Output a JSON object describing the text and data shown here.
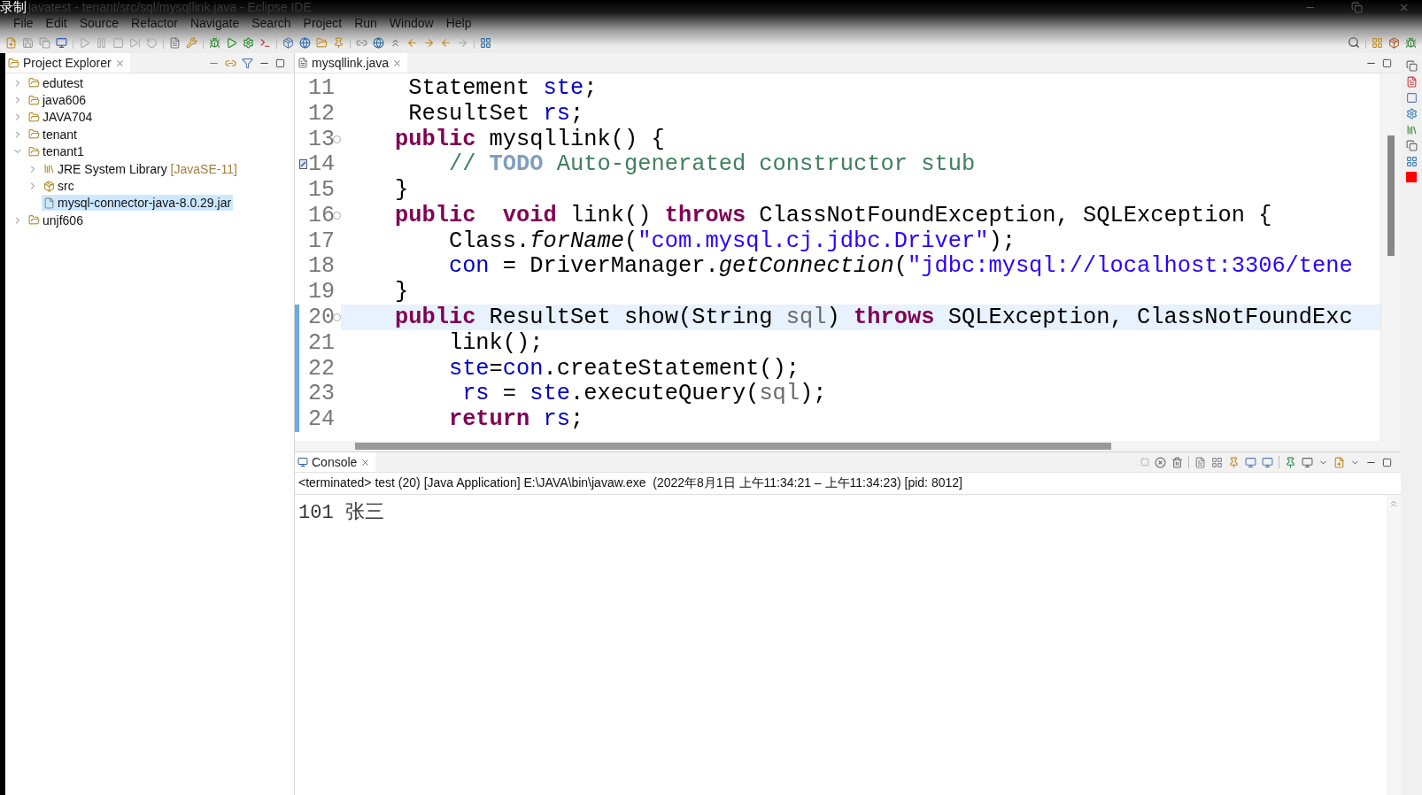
{
  "window": {
    "recording_label": "录制",
    "title": "javatest - tenant/src/sql/mysqllink.java - Eclipse IDE"
  },
  "menu": [
    "File",
    "Edit",
    "Source",
    "Refactor",
    "Navigate",
    "Search",
    "Project",
    "Run",
    "Window",
    "Help"
  ],
  "project_explorer": {
    "tab": "Project Explorer",
    "items": [
      {
        "label": "edutest",
        "kind": "project",
        "expanded": false,
        "selected": false
      },
      {
        "label": "java606",
        "kind": "project",
        "expanded": false,
        "selected": false
      },
      {
        "label": "JAVA704",
        "kind": "project",
        "expanded": false,
        "selected": false
      },
      {
        "label": "tenant",
        "kind": "project",
        "expanded": false,
        "selected": false
      },
      {
        "label": "tenant1",
        "kind": "project",
        "expanded": true,
        "selected": false,
        "children": [
          {
            "label": "JRE System Library",
            "decoration": "[JavaSE-11]",
            "kind": "library",
            "expanded": false,
            "selected": false
          },
          {
            "label": "src",
            "kind": "folder",
            "expanded": false,
            "selected": false
          },
          {
            "label": "mysql-connector-java-8.0.29.jar",
            "kind": "jar",
            "selected": true
          }
        ]
      },
      {
        "label": "unjf606",
        "kind": "project",
        "expanded": false,
        "selected": false
      }
    ]
  },
  "editor": {
    "tab": "mysqllink.java",
    "lines": [
      {
        "number": "11",
        "current": false,
        "in_range": false,
        "tokens": [
          {
            "kind": "plain",
            "text": "     Statement "
          },
          {
            "kind": "field",
            "text": "ste"
          },
          {
            "kind": "plain",
            "text": ";"
          }
        ]
      },
      {
        "number": "12",
        "current": false,
        "in_range": false,
        "tokens": [
          {
            "kind": "plain",
            "text": "     ResultSet "
          },
          {
            "kind": "field",
            "text": "rs"
          },
          {
            "kind": "plain",
            "text": ";"
          }
        ]
      },
      {
        "number": "13",
        "foldable": true,
        "current": false,
        "in_range": false,
        "tokens": [
          {
            "kind": "keyword",
            "text": "    public"
          },
          {
            "kind": "plain",
            "text": " mysqllink() {"
          }
        ]
      },
      {
        "number": "14",
        "task": true,
        "current": false,
        "in_range": false,
        "tokens": [
          {
            "kind": "comment",
            "text": "        // "
          },
          {
            "kind": "todo",
            "text": "TODO"
          },
          {
            "kind": "comment",
            "text": " Auto-generated constructor stub"
          }
        ]
      },
      {
        "number": "15",
        "current": false,
        "in_range": false,
        "tokens": [
          {
            "kind": "plain",
            "text": "    }"
          }
        ]
      },
      {
        "number": "16",
        "foldable": true,
        "current": false,
        "in_range": false,
        "tokens": [
          {
            "kind": "keyword",
            "text": "    public  void"
          },
          {
            "kind": "plain",
            "text": " link() "
          },
          {
            "kind": "keyword",
            "text": "throws"
          },
          {
            "kind": "plain",
            "text": " ClassNotFoundException, SQLException {"
          }
        ]
      },
      {
        "number": "17",
        "current": false,
        "in_range": false,
        "tokens": [
          {
            "kind": "plain",
            "text": "        Class."
          },
          {
            "kind": "method",
            "text": "forName"
          },
          {
            "kind": "plain",
            "text": "("
          },
          {
            "kind": "string",
            "text": "\"com.mysql.cj.jdbc.Driver\""
          },
          {
            "kind": "plain",
            "text": ");"
          }
        ]
      },
      {
        "number": "18",
        "current": false,
        "in_range": false,
        "tokens": [
          {
            "kind": "field",
            "text": "        con"
          },
          {
            "kind": "plain",
            "text": " = DriverManager."
          },
          {
            "kind": "method",
            "text": "getConnection"
          },
          {
            "kind": "plain",
            "text": "("
          },
          {
            "kind": "string",
            "text": "\"jdbc:mysql://localhost:3306/tene"
          }
        ]
      },
      {
        "number": "19",
        "current": false,
        "in_range": false,
        "tokens": [
          {
            "kind": "plain",
            "text": "    }"
          }
        ]
      },
      {
        "number": "20",
        "foldable": true,
        "current": true,
        "in_range": true,
        "tokens": [
          {
            "kind": "keyword",
            "text": "    public"
          },
          {
            "kind": "plain",
            "text": " ResultSet show(String "
          },
          {
            "kind": "param",
            "text": "sql"
          },
          {
            "kind": "plain",
            "text": ") "
          },
          {
            "kind": "keyword",
            "text": "throws"
          },
          {
            "kind": "plain",
            "text": " SQLException, ClassNotFoundExc"
          }
        ]
      },
      {
        "number": "21",
        "current": false,
        "in_range": true,
        "tokens": [
          {
            "kind": "plain",
            "text": "        link();"
          }
        ]
      },
      {
        "number": "22",
        "current": false,
        "in_range": true,
        "tokens": [
          {
            "kind": "field",
            "text": "        ste"
          },
          {
            "kind": "plain",
            "text": "="
          },
          {
            "kind": "field",
            "text": "con"
          },
          {
            "kind": "plain",
            "text": ".createStatement();"
          }
        ]
      },
      {
        "number": "23",
        "current": false,
        "in_range": true,
        "tokens": [
          {
            "kind": "field",
            "text": "         rs"
          },
          {
            "kind": "plain",
            "text": " = "
          },
          {
            "kind": "field",
            "text": "ste"
          },
          {
            "kind": "plain",
            "text": ".executeQuery("
          },
          {
            "kind": "param",
            "text": "sql"
          },
          {
            "kind": "plain",
            "text": ");"
          }
        ]
      },
      {
        "number": "24",
        "current": false,
        "in_range": true,
        "tokens": [
          {
            "kind": "keyword",
            "text": "        return"
          },
          {
            "kind": "field",
            "text": " rs"
          },
          {
            "kind": "plain",
            "text": ";"
          }
        ]
      }
    ]
  },
  "console": {
    "tab": "Console",
    "header": "<terminated> test (20) [Java Application] E:\\JAVA\\bin\\javaw.exe  (2022年8月1日 上午11:34:21 – 上午11:34:23) [pid: 8012]",
    "output": [
      "101 张三"
    ]
  }
}
